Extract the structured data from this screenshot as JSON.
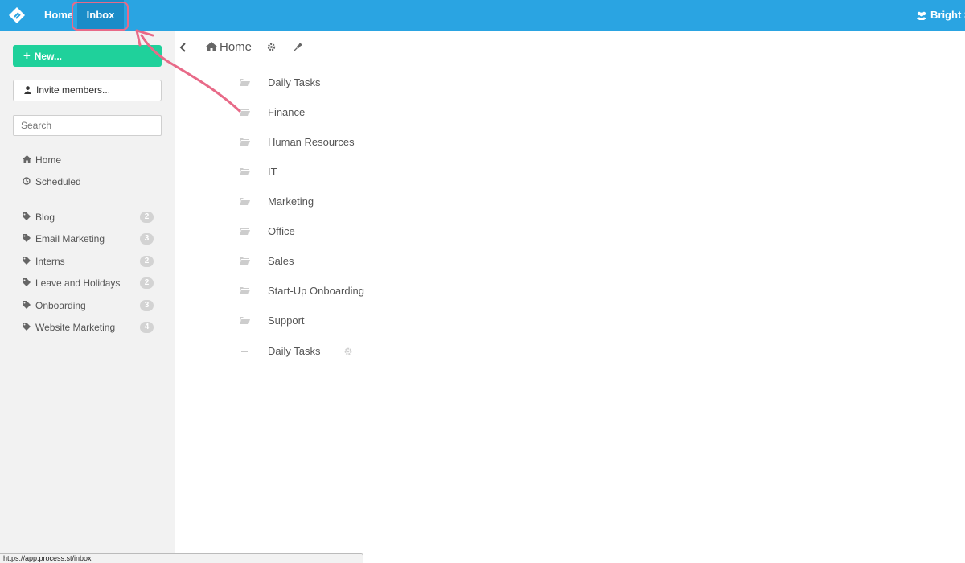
{
  "topbar": {
    "nav": [
      {
        "label": "Home"
      },
      {
        "label": "Inbox"
      }
    ],
    "user_label": "Bright St"
  },
  "sidebar": {
    "new_button": "New...",
    "invite_button": "Invite members...",
    "search_placeholder": "Search",
    "nav_items": [
      {
        "label": "Home",
        "icon": "home-icon"
      },
      {
        "label": "Scheduled",
        "icon": "clock-icon"
      }
    ],
    "tags": [
      {
        "label": "Blog",
        "count": "2"
      },
      {
        "label": "Email Marketing",
        "count": "3"
      },
      {
        "label": "Interns",
        "count": "2"
      },
      {
        "label": "Leave and Holidays",
        "count": "2"
      },
      {
        "label": "Onboarding",
        "count": "3"
      },
      {
        "label": "Website Marketing",
        "count": "4"
      }
    ]
  },
  "main": {
    "breadcrumb": "Home",
    "folders": [
      {
        "label": "Daily Tasks"
      },
      {
        "label": "Finance"
      },
      {
        "label": "Human Resources"
      },
      {
        "label": "IT"
      },
      {
        "label": "Marketing"
      },
      {
        "label": "Office"
      },
      {
        "label": "Sales"
      },
      {
        "label": "Start-Up Onboarding"
      },
      {
        "label": "Support"
      }
    ],
    "checklist_item": "Daily Tasks"
  },
  "status_url": "https://app.process.st/inbox",
  "colors": {
    "topbar": "#2aa4e2",
    "active_tab": "#1b8cc8",
    "new_button": "#1fd19b",
    "annotation": "#e86a88"
  }
}
